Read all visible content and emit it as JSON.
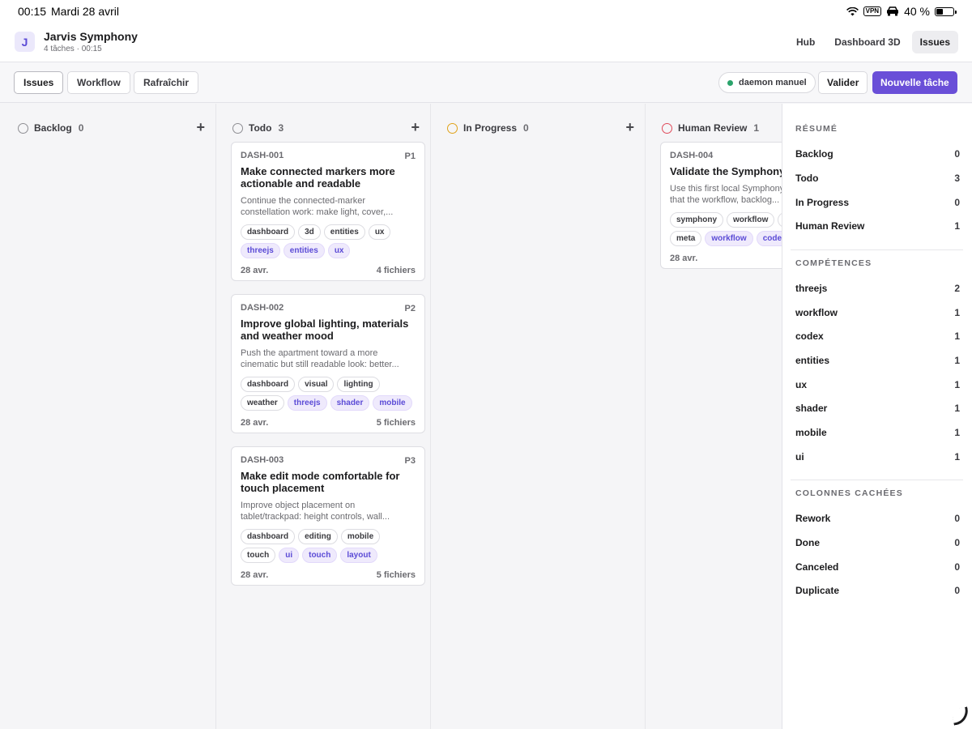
{
  "status_bar": {
    "time": "00:15",
    "date": "Mardi 28 avril",
    "vpn": "VPN",
    "battery": "40 %"
  },
  "header": {
    "avatar": "J",
    "title": "Jarvis Symphony",
    "subtitle": "4 tâches · 00:15",
    "nav": [
      "Hub",
      "Dashboard 3D",
      "Issues"
    ]
  },
  "toolbar": {
    "issues": "Issues",
    "workflow": "Workflow",
    "refresh": "Rafraîchir",
    "daemon": "daemon manuel",
    "validate": "Valider",
    "new_task": "Nouvelle tâche"
  },
  "columns": [
    {
      "name": "Backlog",
      "count": "0",
      "color": "#8e8e93"
    },
    {
      "name": "Todo",
      "count": "3",
      "color": "#8e8e93"
    },
    {
      "name": "In Progress",
      "count": "0",
      "color": "#e0a219"
    },
    {
      "name": "Human Review",
      "count": "1",
      "color": "#e04a5a"
    }
  ],
  "cards": [
    {
      "id": "DASH-001",
      "priority": "P1",
      "title": "Make connected markers more actionable and readable",
      "desc": "Continue the connected-marker constellation work: make light, cover,...",
      "tags": [
        "dashboard",
        "3d",
        "entities",
        "ux"
      ],
      "accent_tags": [
        "threejs",
        "entities",
        "ux"
      ],
      "date": "28 avr.",
      "files": "4 fichiers"
    },
    {
      "id": "DASH-002",
      "priority": "P2",
      "title": "Improve global lighting, materials and weather mood",
      "desc": "Push the apartment toward a more cinematic but still readable look: better...",
      "tags": [
        "dashboard",
        "visual",
        "lighting",
        "weather"
      ],
      "accent_tags": [
        "threejs",
        "shader",
        "mobile"
      ],
      "date": "28 avr.",
      "files": "5 fichiers"
    },
    {
      "id": "DASH-003",
      "priority": "P3",
      "title": "Make edit mode comfortable for touch placement",
      "desc": "Improve object placement on tablet/trackpad: height controls, wall...",
      "tags": [
        "dashboard",
        "editing",
        "mobile",
        "touch"
      ],
      "accent_tags": [
        "ui",
        "touch",
        "layout"
      ],
      "date": "28 avr.",
      "files": "5 fichiers"
    },
    {
      "id": "DASH-004",
      "priority": "",
      "title": "Validate the Symphony lab itself",
      "desc": "Use this first local Symphony task to prove that the workflow, backlog...",
      "tags": [
        "symphony",
        "workflow",
        "",
        "meta"
      ],
      "accent_tags": [
        "workflow",
        "codex"
      ],
      "date": "28 avr.",
      "files": ""
    }
  ],
  "summary": {
    "title": "RÉSUMÉ",
    "rows": [
      {
        "label": "Backlog",
        "value": "0"
      },
      {
        "label": "Todo",
        "value": "3"
      },
      {
        "label": "In Progress",
        "value": "0"
      },
      {
        "label": "Human Review",
        "value": "1"
      }
    ]
  },
  "skills": {
    "title": "COMPÉTENCES",
    "rows": [
      {
        "label": "threejs",
        "value": "2"
      },
      {
        "label": "workflow",
        "value": "1"
      },
      {
        "label": "codex",
        "value": "1"
      },
      {
        "label": "entities",
        "value": "1"
      },
      {
        "label": "ux",
        "value": "1"
      },
      {
        "label": "shader",
        "value": "1"
      },
      {
        "label": "mobile",
        "value": "1"
      },
      {
        "label": "ui",
        "value": "1"
      }
    ]
  },
  "hidden_columns": {
    "title": "COLONNES CACHÉES",
    "rows": [
      {
        "label": "Rework",
        "value": "0"
      },
      {
        "label": "Done",
        "value": "0"
      },
      {
        "label": "Canceled",
        "value": "0"
      },
      {
        "label": "Duplicate",
        "value": "0"
      }
    ]
  }
}
